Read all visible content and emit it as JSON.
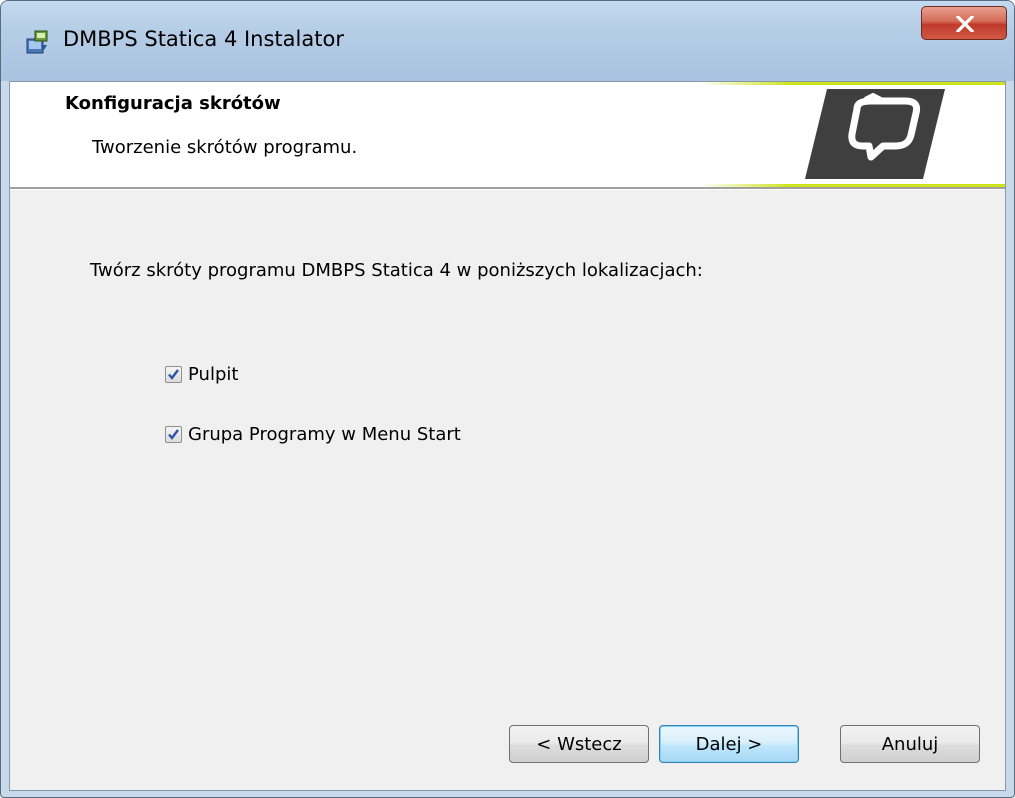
{
  "window": {
    "title": "DMBPS Statica 4 Instalator",
    "icons": {
      "app": "installer-icon",
      "close": "close-icon"
    }
  },
  "banner": {
    "title": "Konfiguracja skrótów",
    "subtitle": "Tworzenie skrótów programu.",
    "logo_icon": "speech-bubble-logo",
    "accent_color": "#cde21a"
  },
  "main": {
    "instruction": "Twórz skróty programu DMBPS Statica 4 w poniższych lokalizacjach:",
    "options": [
      {
        "label": "Pulpit",
        "checked": true
      },
      {
        "label": "Grupa Programy w Menu Start",
        "checked": true
      }
    ]
  },
  "buttons": {
    "back": "< Wstecz",
    "next": "Dalej >",
    "cancel": "Anuluj"
  }
}
